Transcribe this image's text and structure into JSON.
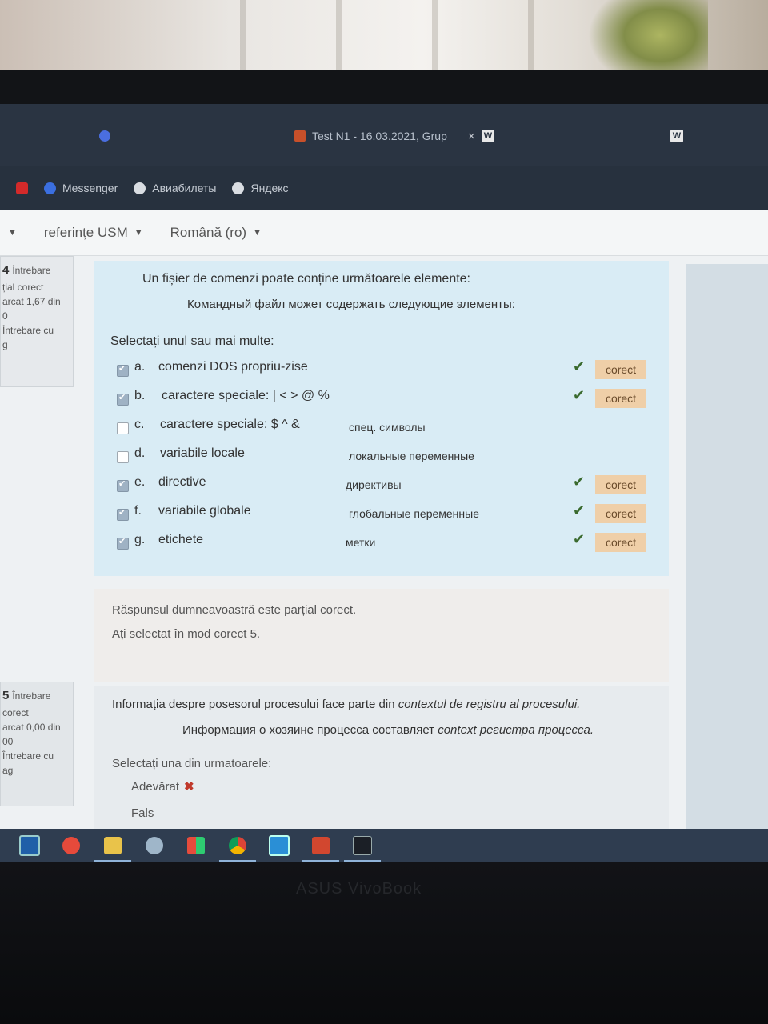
{
  "browser": {
    "tabs": [
      {
        "label": "Test N1 - 16.03.2021, Grup",
        "close": "×"
      },
      {
        "label": "W"
      },
      {
        "label": "W"
      }
    ],
    "bookmarks": [
      "Messenger",
      "Авиабилеты",
      "Яндекс"
    ]
  },
  "nav": {
    "items": [
      "referințe USM",
      "Română (ro)"
    ]
  },
  "question1": {
    "info": {
      "number": "4",
      "label": "Întrebare",
      "status": "țial corect",
      "score": "arcat 1,67 din",
      "score2": "0",
      "flag": "Întrebare cu",
      "flag2": "g"
    },
    "text_ro": "Un fișier de comenzi poate conține următoarele elemente:",
    "text_ru": "Командный файл может содержать следующие элементы:",
    "prompt": "Selectați unul sau mai multe:",
    "options": [
      {
        "letter": "a.",
        "text": "comenzi DOS propriu-zise",
        "ru": "",
        "checked": true,
        "correct": true,
        "badge": "corect"
      },
      {
        "letter": "b.",
        "text": "caractere speciale: | < > @ %",
        "ru": "",
        "checked": true,
        "correct": true,
        "badge": "corect"
      },
      {
        "letter": "c.",
        "text": "caractere speciale: $ ^ &",
        "ru": "спец. символы",
        "checked": false,
        "correct": false,
        "badge": ""
      },
      {
        "letter": "d.",
        "text": "variabile locale",
        "ru": "локальные переменные",
        "checked": false,
        "correct": false,
        "badge": ""
      },
      {
        "letter": "e.",
        "text": "directive",
        "ru": "директивы",
        "checked": true,
        "correct": true,
        "badge": "corect"
      },
      {
        "letter": "f.",
        "text": "variabile globale",
        "ru": "глобальные переменные",
        "checked": true,
        "correct": true,
        "badge": "corect"
      },
      {
        "letter": "g.",
        "text": "etichete",
        "ru": "метки",
        "checked": true,
        "correct": true,
        "badge": "corect"
      }
    ],
    "feedback": {
      "line1": "Răspunsul dumneavoastră este parțial corect.",
      "line2": "Ați selectat în mod corect 5."
    }
  },
  "question2": {
    "info": {
      "number": "5",
      "label": "Întrebare",
      "status": "corect",
      "score": "arcat 0,00 din",
      "score2": "00",
      "flag": "Întrebare cu",
      "flag2": "ag"
    },
    "text_ro_a": "Informația despre posesorul procesului face parte din ",
    "text_ro_b": "contextul de registru al procesului.",
    "text_ru_a": "Информация о хозяине процесса составляет ",
    "text_ru_b": "context регистра процесса.",
    "prompt": "Selectați una din urmatoarele:",
    "answers": [
      {
        "label": "Adevărat",
        "mark": "✖"
      },
      {
        "label": "Fals",
        "mark": ""
      }
    ]
  },
  "device": {
    "brand": "ASUS VivoBook"
  },
  "colors": {
    "accent_badge": "#efcfa8",
    "tick": "#3a6a2e",
    "question_bg": "#d9ecf5"
  }
}
